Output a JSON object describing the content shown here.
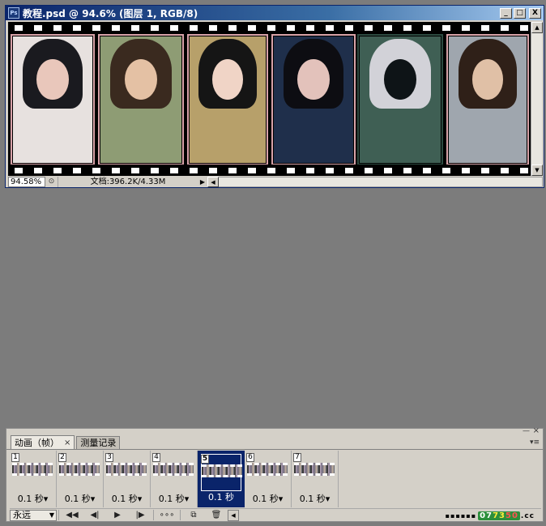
{
  "document": {
    "title": "教程.psd @ 94.6% (图层 1, RGB/8)",
    "app_icon": "Ps",
    "window_buttons": {
      "minimize": "_",
      "maximize": "□",
      "close": "X"
    },
    "zoom": "94.58%",
    "doc_info": "文档:396.2K/4.33M"
  },
  "filmstrip": {
    "photos": [
      {
        "bg": "#e7e1df",
        "hair": "#1a1a1f",
        "face": "#e9c7bb",
        "border": "#d8a2a8"
      },
      {
        "bg": "#8e9c74",
        "hair": "#3a2a1f",
        "face": "#e4c1a4",
        "border": "#d8a2a8"
      },
      {
        "bg": "#b7a06a",
        "hair": "#151515",
        "face": "#f0d4c6",
        "border": "#d8a2a8"
      },
      {
        "bg": "#1f2f4b",
        "hair": "#0d0d12",
        "face": "#e3c2bb",
        "border": "#d8a2a8"
      },
      {
        "bg": "#3f5f54",
        "hair": "#d2d2d8",
        "face": "#0e1417",
        "border": "#2c4a40"
      },
      {
        "bg": "#9fa6ae",
        "hair": "#2f2018",
        "face": "#e0c0a6",
        "border": "#d8a2a8"
      }
    ]
  },
  "animation_panel": {
    "tabs": [
      {
        "label": "动画（帧）",
        "active": true
      },
      {
        "label": "测量记录",
        "active": false
      }
    ],
    "frames": [
      {
        "number": "1",
        "delay": "0.1 秒▾"
      },
      {
        "number": "2",
        "delay": "0.1 秒▾"
      },
      {
        "number": "3",
        "delay": "0.1 秒▾"
      },
      {
        "number": "4",
        "delay": "0.1 秒▾"
      },
      {
        "number": "5",
        "delay": "0.1 秒",
        "selected": true
      },
      {
        "number": "6",
        "delay": "0.1 秒▾"
      },
      {
        "number": "7",
        "delay": "0.1 秒▾"
      }
    ],
    "loop_option": "永远",
    "controls": {
      "first": "◀◀",
      "prev": "◀|",
      "play": "▶",
      "next": "|▶",
      "tween": "∘∘∘",
      "duplicate": "⧉",
      "delete": "🗑"
    }
  },
  "watermark": {
    "dots": "▪▪▪▪▪▪",
    "part1": "07",
    "part2": "73",
    "part3": "50",
    "suffix": ".cc"
  }
}
